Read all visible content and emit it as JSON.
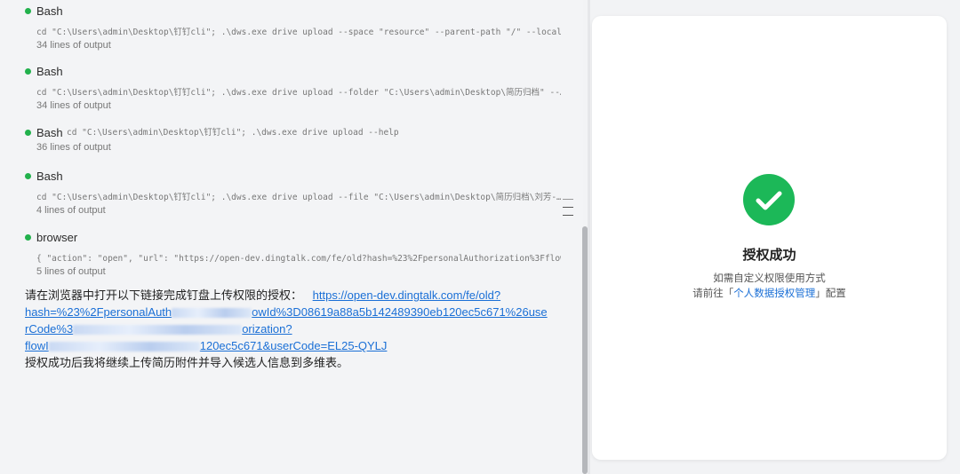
{
  "steps": [
    {
      "title": "Bash",
      "cmd": "cd \"C:\\Users\\admin\\Desktop\\钉钉cli\"; .\\dws.exe drive upload --space \"resource\" --parent-path \"/\" --local…",
      "output": "34 lines of output"
    },
    {
      "title": "Bash",
      "cmd": "cd \"C:\\Users\\admin\\Desktop\\钉钉cli\"; .\\dws.exe drive upload --folder \"C:\\Users\\admin\\Desktop\\简历归档\" --…",
      "output": "34 lines of output"
    },
    {
      "title": "Bash",
      "cmd": "cd \"C:\\Users\\admin\\Desktop\\钉钉cli\"; .\\dws.exe drive upload --help",
      "output": "36 lines of output"
    },
    {
      "title": "Bash",
      "cmd": "cd \"C:\\Users\\admin\\Desktop\\钉钉cli\"; .\\dws.exe drive upload --file \"C:\\Users\\admin\\Desktop\\简历归档\\刘芳-…",
      "output": "4 lines of output"
    },
    {
      "title": "browser",
      "cmd": "{ \"action\": \"open\", \"url\": \"https://open-dev.dingtalk.com/fe/old?hash=%23%2FpersonalAuthorization%3Fflow…",
      "output": "5 lines of output"
    }
  ],
  "message": {
    "intro": "请在浏览器中打开以下链接完成钉盘上传权限的授权：",
    "link_1": "https://open-dev.dingtalk.com/fe/old?",
    "link_2a": "hash=%23%2FpersonalAuth",
    "link_2b": "owId%3D08619a88a5b142489390eb120ec5c671%26use",
    "link_3a": "rCode%3",
    "link_3b": "orization?",
    "link_4a": "flowI",
    "link_4b": "120ec5c671&userCode=EL25-QYLJ",
    "after": "授权成功后我将继续上传简历附件并导入候选人信息到多维表。"
  },
  "success": {
    "title": "授权成功",
    "subtitle": "如需自定义权限使用方式",
    "link_prefix": "请前往「",
    "link_text": "个人数据授权管理",
    "link_suffix": "」配置"
  },
  "colors": {
    "accent": "#1a6fd6",
    "success": "#1cb858",
    "status_dot": "#22b14c"
  }
}
